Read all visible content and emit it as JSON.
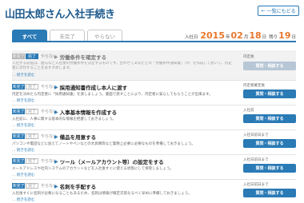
{
  "page": {
    "title": "山田太郎さん入社手続き",
    "back_label": "一覧にもどる"
  },
  "tabs": [
    {
      "label": "すべて"
    },
    {
      "label": "未完了"
    },
    {
      "label": "やらない"
    }
  ],
  "join_date": {
    "label": "入社日",
    "year": "2015",
    "year_unit": "年",
    "month": "02",
    "month_unit": "月",
    "day": "18",
    "day_unit": "日",
    "weekday_prefix": "残り",
    "weekday": "19",
    "weekday_unit": "日"
  },
  "status_labels": {
    "undone": "未完了",
    "done": "完了",
    "later": "やらない"
  },
  "tasks": [
    {
      "title": "労働条件を確定する",
      "desc": "入社する前提は、給与など入社後の労働条件を決定するものです。合わせてあなたとの「労働条件通知書」（※）を作成しておいて、内定者に交付することをおすすめします。",
      "more": "… 続きを読む",
      "due": "内定後",
      "button": "質問・相談する",
      "state": "done"
    },
    {
      "title": "採用通知書作成し本人に渡す",
      "desc": "内定を決めたら内定者に「採用通知書」を渡しましょう。書面で渡すことにより、内定者に安心してもらうことが出来ます。",
      "more": "… 続きを読む",
      "due": "内定者確定後",
      "button": "質問・相談する",
      "state": "undone"
    },
    {
      "title": "入事基本情報を作成する",
      "desc": "入社前に、人事に関する基本的な情報を把握しておきましょう。",
      "more": "… 続きを読む",
      "due": "入社前",
      "button": "質問・相談する",
      "state": "undone"
    },
    {
      "title": "備品を用意する",
      "desc": "パソコンや電話などに加えてノートやペンなどの文具類等など業務上必要に必要なものを準備しておきましょう。",
      "more": "… 続きを読む",
      "due": "入社日前日まで",
      "button": "質問・相談する",
      "state": "undone"
    },
    {
      "title": "ツール（メールアカウント等）の設定をする",
      "desc": "メールアドレスや社内システムのアカウントなどを入社後すぐに使える状態にして保管しましょう。",
      "more": "… 続きを読む",
      "due": "入社日前日まで",
      "button": "質問・相談する",
      "state": "undone"
    },
    {
      "title": "名刺を手配する",
      "desc": "入社後すぐに名刺が必要になることもあるため、名刺は情報が確定次第なるべく早めに準備しておきましょう。",
      "more": "… 続きを読む",
      "due": "入社日前日まで",
      "button": "質問・相談する",
      "state": "undone"
    }
  ]
}
